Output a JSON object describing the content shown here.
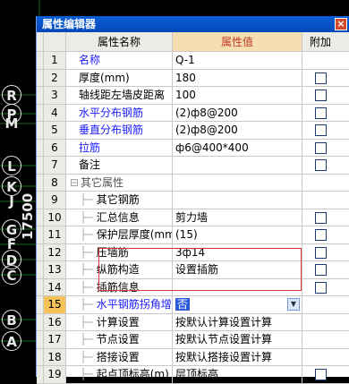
{
  "cad": {
    "axis_labels": [
      "R",
      "P",
      "M",
      "L",
      "K",
      "J",
      "G",
      "F",
      "D",
      "C",
      "B",
      "A"
    ],
    "dimension_text": "17500"
  },
  "window": {
    "title": "属性编辑器",
    "close_glyph": "×",
    "headers": {
      "name": "属性名称",
      "value": "属性值",
      "extra": "附加"
    },
    "rows": [
      {
        "num": "1",
        "name": "名称",
        "value": "Q-1",
        "blue": true,
        "check": false,
        "indent": false
      },
      {
        "num": "2",
        "name": "厚度(mm)",
        "value": "180",
        "blue": false,
        "check": true,
        "indent": false
      },
      {
        "num": "3",
        "name": "轴线距左墙皮距离",
        "value": "100",
        "blue": false,
        "check": true,
        "indent": false
      },
      {
        "num": "4",
        "name": "水平分布钢筋",
        "value": "(2)ф8@200",
        "blue": true,
        "check": true,
        "indent": false
      },
      {
        "num": "5",
        "name": "垂直分布钢筋",
        "value": "(2)ф8@200",
        "blue": true,
        "check": true,
        "indent": false
      },
      {
        "num": "6",
        "name": "拉筋",
        "value": "ф6@400*400",
        "blue": true,
        "check": true,
        "indent": false
      },
      {
        "num": "7",
        "name": "备注",
        "value": "",
        "blue": false,
        "check": true,
        "indent": false
      },
      {
        "num": "8",
        "name": "其它属性",
        "value": "",
        "blue": false,
        "check": false,
        "indent": false,
        "group": true,
        "toggle": "−"
      },
      {
        "num": "9",
        "name": "其它钢筋",
        "value": "",
        "blue": false,
        "check": false,
        "indent": true
      },
      {
        "num": "10",
        "name": "汇总信息",
        "value": "剪力墙",
        "blue": false,
        "check": true,
        "indent": true
      },
      {
        "num": "11",
        "name": "保护层厚度(mm)",
        "value": "(15)",
        "blue": false,
        "check": true,
        "indent": true
      },
      {
        "num": "12",
        "name": "压墙筋",
        "value": "3ф14",
        "blue": false,
        "check": true,
        "indent": true
      },
      {
        "num": "13",
        "name": "纵筋构造",
        "value": "设置插筋",
        "blue": false,
        "check": true,
        "indent": true
      },
      {
        "num": "14",
        "name": "插筋信息",
        "value": "",
        "blue": false,
        "check": true,
        "indent": true
      },
      {
        "num": "15",
        "name": "水平钢筋拐角增",
        "value": "否",
        "blue": true,
        "check": false,
        "indent": true,
        "selected": true
      },
      {
        "num": "16",
        "name": "计算设置",
        "value": "按默认计算设置计算",
        "blue": false,
        "check": false,
        "indent": true
      },
      {
        "num": "17",
        "name": "节点设置",
        "value": "按默认节点设置计算",
        "blue": false,
        "check": false,
        "indent": true
      },
      {
        "num": "18",
        "name": "搭接设置",
        "value": "按默认搭接设置计算",
        "blue": false,
        "check": false,
        "indent": true
      },
      {
        "num": "19",
        "name": "起点顶标高(m)",
        "value": "层顶标高",
        "blue": false,
        "check": true,
        "indent": true
      }
    ]
  }
}
